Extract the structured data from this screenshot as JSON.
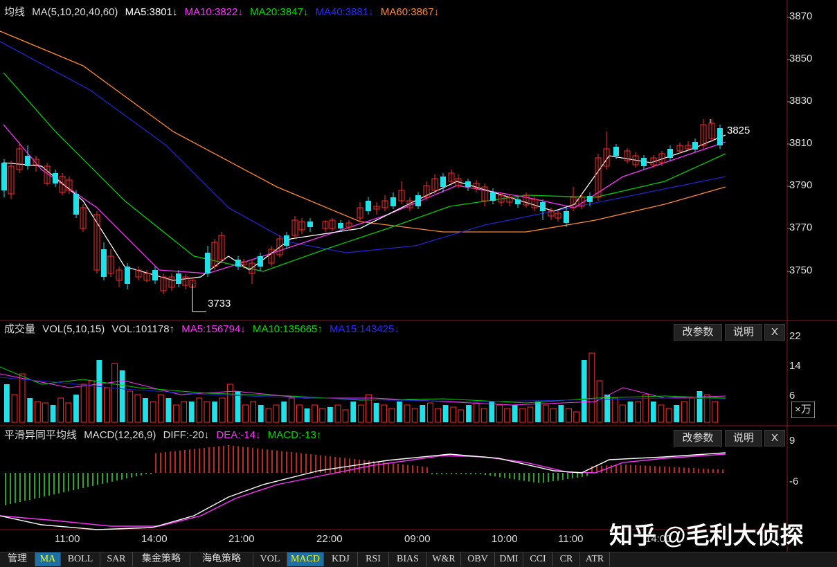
{
  "main_panel": {
    "indicator": "均线",
    "params": "MA(5,10,20,40,60)",
    "ma5": "MA5:3801↓",
    "ma10": "MA10:3822↓",
    "ma20": "MA20:3847↓",
    "ma40": "MA40:3881↓",
    "ma60": "MA60:3867↓",
    "colors": {
      "ma5": "#ffffff",
      "ma10": "#ff33ff",
      "ma20": "#00cc00",
      "ma40": "#2222cc",
      "ma60": "#ff8833",
      "up": "#ff2a2a",
      "down": "#22e0e8"
    },
    "y_ticks": [
      "3870",
      "3850",
      "3830",
      "3810",
      "3790",
      "3770",
      "3750"
    ],
    "low_label": "3733",
    "high_label": "3825"
  },
  "volume_panel": {
    "title": "成交量",
    "params": "VOL(5,10,15)",
    "vol": "VOL:101178↑",
    "ma5": "MA5:156794↓",
    "ma10": "MA10:135665↑",
    "ma15": "MA15:143425↓",
    "modify_label": "改参数",
    "help_label": "说明",
    "close_label": "X",
    "y_ticks": [
      "22",
      "14",
      "6"
    ],
    "unit_label": "×万"
  },
  "macd_panel": {
    "title": "平滑异同平均线",
    "params": "MACD(12,26,9)",
    "diff": "DIFF:-20↓",
    "dea": "DEA:-14↓",
    "macd": "MACD:-13↑",
    "modify_label": "改参数",
    "help_label": "说明",
    "close_label": "X",
    "y_ticks": [
      "9",
      "-6"
    ]
  },
  "x_axis": [
    "11:00",
    "14:00",
    "21:00",
    "22:00",
    "09:00",
    "10:00",
    "11:00",
    "14:00"
  ],
  "tabs": [
    "管理",
    "MA",
    "BOLL",
    "SAR",
    "集金策略",
    "海龟策略",
    "VOL",
    "MACD",
    "KDJ",
    "RSI",
    "BIAS",
    "W&R",
    "OBV",
    "DMI",
    "CCI",
    "CR",
    "ATR"
  ],
  "active_tabs": [
    "MA",
    "MACD"
  ],
  "watermark": "知乎 @毛利大侦探"
}
